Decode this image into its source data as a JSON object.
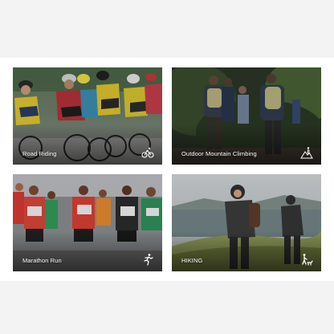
{
  "categories": [
    {
      "id": "road",
      "label": "Road Riding",
      "icon": "cycling-icon"
    },
    {
      "id": "mountain",
      "label": "Outdoor Mountain Climbing",
      "icon": "mountain-climbing-icon"
    },
    {
      "id": "marathon",
      "label": "Marathon Run",
      "icon": "running-icon"
    },
    {
      "id": "hiking",
      "label": "HIKING",
      "icon": "hiking-with-dog-icon"
    }
  ],
  "colors": {
    "page_background": "#f3f3f3",
    "panel_background": "#ffffff",
    "label_text": "#ffffff"
  }
}
